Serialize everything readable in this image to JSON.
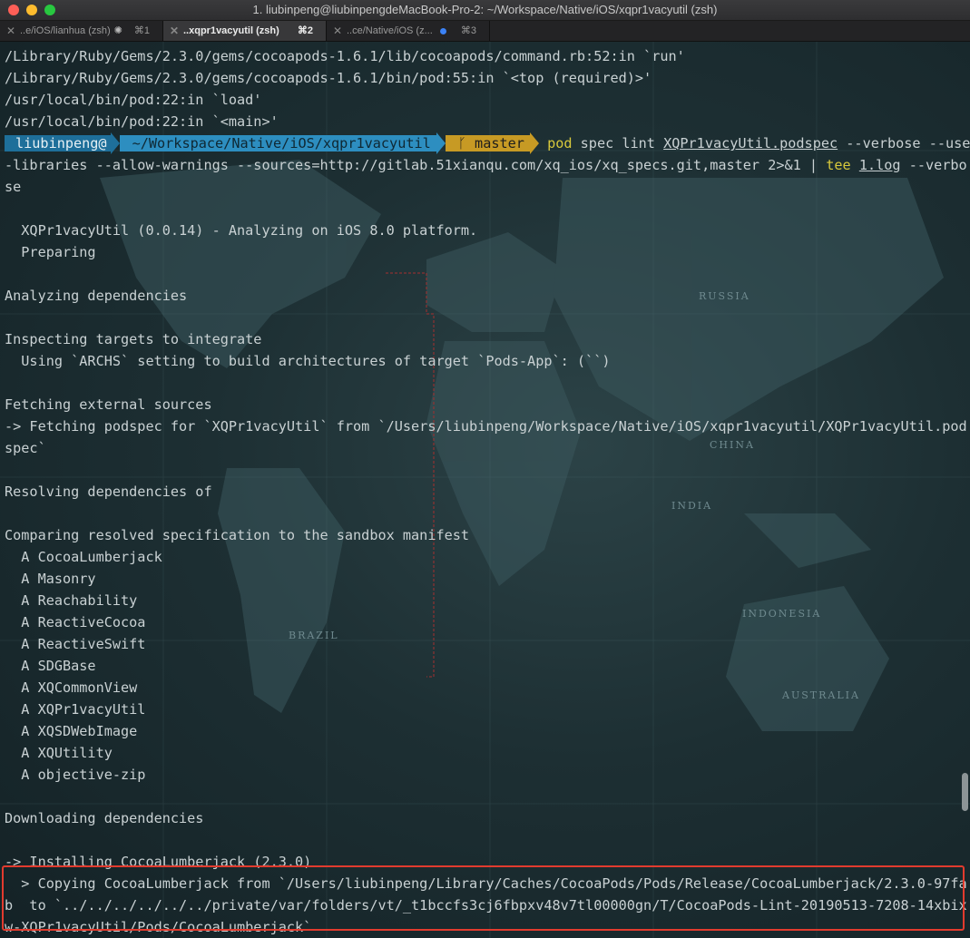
{
  "window": {
    "title": "1. liubinpeng@liubinpengdeMacBook-Pro-2: ~/Workspace/Native/iOS/xqpr1vacyutil (zsh)"
  },
  "tabs": [
    {
      "label": "..e/iOS/lianhua (zsh)",
      "shortcut": "⌘1",
      "active": false
    },
    {
      "label": "..xqpr1vacyutil (zsh)",
      "shortcut": "⌘2",
      "active": true
    },
    {
      "label": "..ce/Native/iOS (z...",
      "shortcut": "⌘3",
      "active": false
    }
  ],
  "prompt": {
    "user": "liubinpeng@",
    "path": "~/Workspace/Native/iOS/xqpr1vacyutil",
    "branch_icon": "ᚴ",
    "branch": "master",
    "cmd_name": "pod",
    "cmd_rest1": " spec lint ",
    "cmd_file": "XQPr1vacyUtil.podspec",
    "cmd_rest2": " --verbose --use",
    "cmd_line2a": "-libraries --allow-warnings --sources=http://gitlab.51xianqu.com/xq_ios/xq_specs.git,master 2>&1 | ",
    "cmd_tee": "tee",
    "cmd_space": " ",
    "cmd_log": "1.log",
    "cmd_line2b": " --verbo",
    "cmd_line3": "se"
  },
  "output_before": [
    "/Library/Ruby/Gems/2.3.0/gems/cocoapods-1.6.1/lib/cocoapods/command.rb:52:in `run'",
    "/Library/Ruby/Gems/2.3.0/gems/cocoapods-1.6.1/bin/pod:55:in `<top (required)>'",
    "/usr/local/bin/pod:22:in `load'",
    "/usr/local/bin/pod:22:in `<main>'"
  ],
  "output_after": [
    "",
    "  XQPr1vacyUtil (0.0.14) - Analyzing on iOS 8.0 platform.",
    "  Preparing",
    "",
    "Analyzing dependencies",
    "",
    "Inspecting targets to integrate",
    "  Using `ARCHS` setting to build architectures of target `Pods-App`: (``)",
    "",
    "Fetching external sources",
    "-> Fetching podspec for `XQPr1vacyUtil` from `/Users/liubinpeng/Workspace/Native/iOS/xqpr1vacyutil/XQPr1vacyUtil.pod",
    "spec`",
    "",
    "Resolving dependencies of",
    "",
    "Comparing resolved specification to the sandbox manifest",
    "  A CocoaLumberjack",
    "  A Masonry",
    "  A Reachability",
    "  A ReactiveCocoa",
    "  A ReactiveSwift",
    "  A SDGBase",
    "  A XQCommonView",
    "  A XQPr1vacyUtil",
    "  A XQSDWebImage",
    "  A XQUtility",
    "  A objective-zip",
    "",
    "Downloading dependencies",
    "",
    "-> Installing CocoaLumberjack (2.3.0)",
    "  > Copying CocoaLumberjack from `/Users/liubinpeng/Library/Caches/CocoaPods/Pods/Release/CocoaLumberjack/2.3.0-97fa",
    "b  to `../../../../../../private/var/folders/vt/_t1bccfs3cj6fbpxv48v7tl00000gn/T/CocoaPods-Lint-20190513-7208-14xbix",
    "w-XQPr1vacyUtil/Pods/CocoaLumberjack`"
  ],
  "map_labels": [
    "RUSSIA",
    "CHINA",
    "INDIA",
    "BRAZIL",
    "INDONESIA",
    "AUSTRALIA"
  ],
  "colors": {
    "prompt_user_bg": "#1e6f9a",
    "prompt_path_bg": "#2d8ec0",
    "prompt_branch_bg": "#c79a24",
    "highlight_box": "#e23b2e",
    "command_name": "#d8c93c"
  }
}
